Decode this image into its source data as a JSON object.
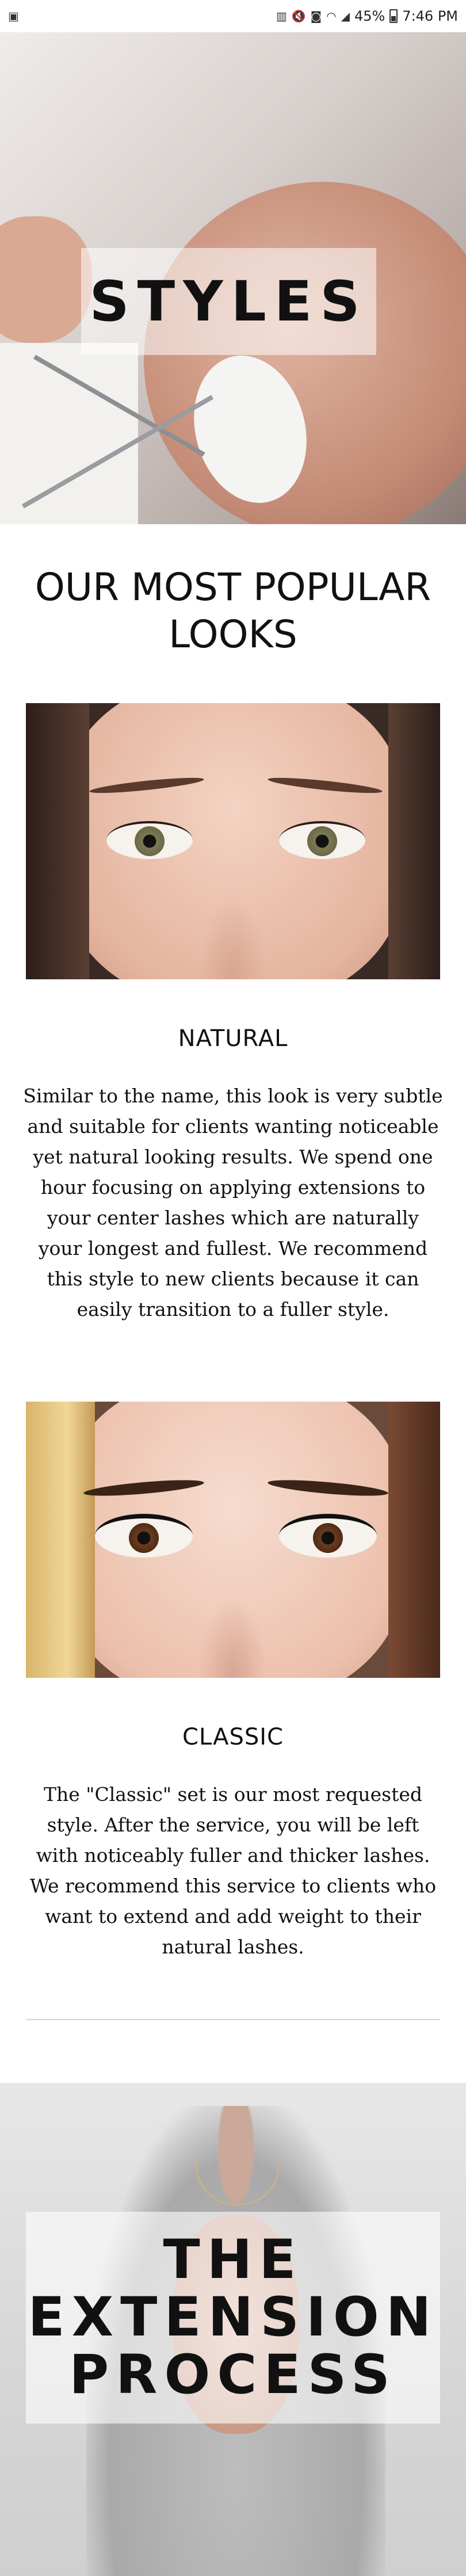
{
  "status_bar": {
    "left_icon": "image-icon",
    "icons": [
      "sim-icon",
      "mute-icon",
      "nfc-icon",
      "wifi-icon",
      "signal-icon"
    ],
    "battery": "45%",
    "time": "7:46 PM"
  },
  "hero": {
    "title": "STYLES"
  },
  "section": {
    "title": "OUR MOST POPULAR LOOKS"
  },
  "looks": [
    {
      "name": "NATURAL",
      "description": "Similar to the name, this look is very subtle and suitable for clients wanting noticeable yet natural looking results. We spend one hour focusing on applying extensions to your center lashes which are naturally your longest and fullest. We recommend this style to new clients because it can easily transition to a fuller style."
    },
    {
      "name": "CLASSIC",
      "description": "The \"Classic\" set is our most requested style. After the service, you will be left with noticeably fuller and thicker lashes. We recommend this service to clients who want to extend and add weight to their natural lashes."
    }
  ],
  "process": {
    "title": "THE\nEXTENSION\nPROCESS"
  }
}
